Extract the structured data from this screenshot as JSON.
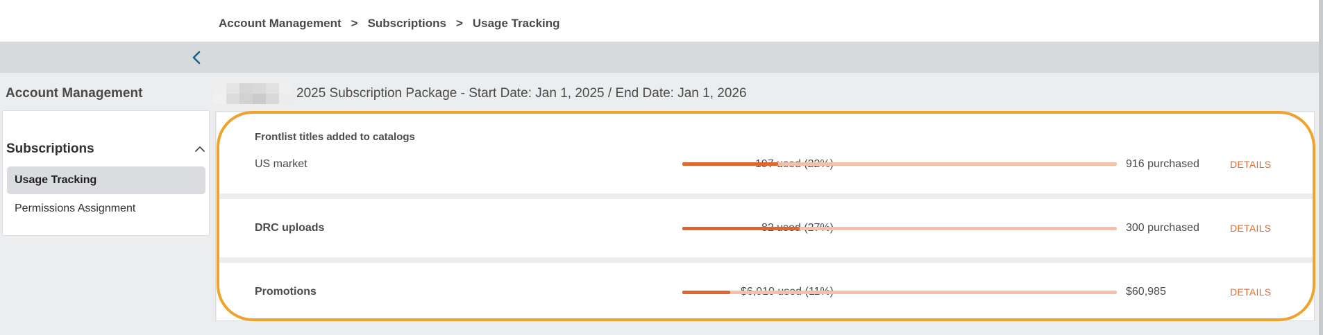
{
  "breadcrumb": {
    "items": [
      "Account Management",
      "Subscriptions",
      "Usage Tracking"
    ],
    "separator": ">"
  },
  "sidebar": {
    "title": "Account Management",
    "section_label": "Subscriptions",
    "items": [
      {
        "label": "Usage Tracking",
        "active": true
      },
      {
        "label": "Permissions Assignment",
        "active": false
      }
    ]
  },
  "package": {
    "title": "2025 Subscription Package - Start Date: Jan 1, 2025 / End Date: Jan 1, 2026"
  },
  "usage": {
    "rows": [
      {
        "heading": "Frontlist titles added to catalogs",
        "label": "US market",
        "used_text": "197 used (22%)",
        "used_fraction": 0.22,
        "total_text": "916 purchased",
        "action_label": "DETAILS"
      },
      {
        "label": "DRC uploads",
        "used_text": "82 used (27%)",
        "used_fraction": 0.27,
        "total_text": "300 purchased",
        "action_label": "DETAILS"
      },
      {
        "label": "Promotions",
        "used_text": "$6,910 used (11%)",
        "used_fraction": 0.11,
        "total_text": "$60,985",
        "action_label": "DETAILS"
      }
    ]
  },
  "icons": {
    "collapse": "chevron-left-icon",
    "section_toggle": "chevron-up-icon"
  },
  "colors": {
    "accent": "#e2652e",
    "bar_track": "#f5c0a9",
    "highlight": "#f0a32a",
    "link": "#e16a2c"
  }
}
